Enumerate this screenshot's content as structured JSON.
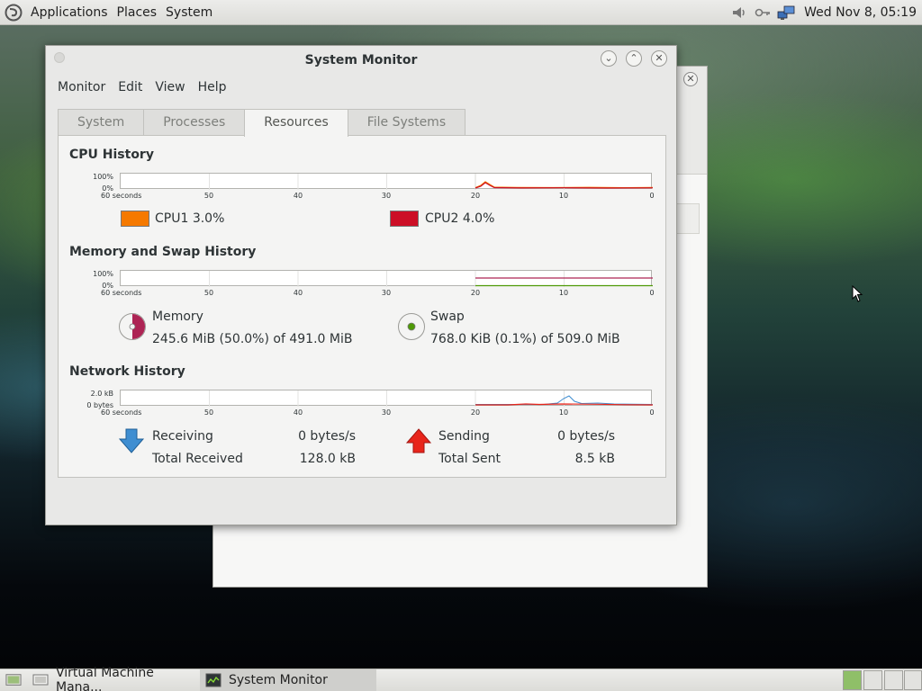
{
  "top_panel": {
    "menus": [
      "Applications",
      "Places",
      "System"
    ],
    "clock": "Wed Nov  8, 05:19"
  },
  "window": {
    "title": "System Monitor",
    "menubar": [
      "Monitor",
      "Edit",
      "View",
      "Help"
    ],
    "tabs": [
      "System",
      "Processes",
      "Resources",
      "File Systems"
    ],
    "active_tab": "Resources"
  },
  "cpu": {
    "title": "CPU History",
    "y_max": "100%",
    "y_min": "0%",
    "x_labels": [
      "60 seconds",
      "50",
      "40",
      "30",
      "20",
      "10",
      "0"
    ],
    "legend": [
      {
        "label": "CPU1",
        "value": "3.0%",
        "color": "#f57900"
      },
      {
        "label": "CPU2",
        "value": "4.0%",
        "color": "#cc0f26"
      }
    ]
  },
  "memory": {
    "title": "Memory and Swap History",
    "y_max": "100%",
    "y_min": "0%",
    "x_labels": [
      "60 seconds",
      "50",
      "40",
      "30",
      "20",
      "10",
      "0"
    ],
    "memory_label": "Memory",
    "memory_detail": "245.6 MiB (50.0%) of 491.0 MiB",
    "memory_fraction": 0.5,
    "memory_color": "#ad2454",
    "swap_label": "Swap",
    "swap_detail": "768.0 KiB (0.1%) of 509.0 MiB",
    "swap_fraction": 0.001,
    "swap_color": "#4e9a06"
  },
  "network": {
    "title": "Network History",
    "y_max": "2.0 kB",
    "y_min": "0 bytes",
    "x_labels": [
      "60 seconds",
      "50",
      "40",
      "30",
      "20",
      "10",
      "0"
    ],
    "receiving_label": "Receiving",
    "receiving_value": "0 bytes/s",
    "total_received_label": "Total Received",
    "total_received_value": "128.0 kB",
    "sending_label": "Sending",
    "sending_value": "0 bytes/s",
    "total_sent_label": "Total Sent",
    "total_sent_value": "8.5 kB",
    "receiving_color": "#3f8ed1",
    "sending_color": "#e8251b"
  },
  "taskbar": {
    "items": [
      "Virtual Machine Mana...",
      "System Monitor"
    ]
  }
}
